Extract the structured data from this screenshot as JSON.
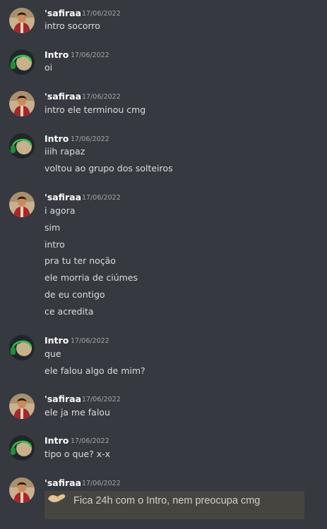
{
  "messages": [
    {
      "author": "'safiraa",
      "timestamp": "17/06/2022",
      "lines": [
        "intro socorro"
      ]
    },
    {
      "author": "Intro",
      "timestamp": "17/06/2022",
      "lines": [
        "oi"
      ]
    },
    {
      "author": "'safiraa",
      "timestamp": "17/06/2022",
      "lines": [
        "intro ele terminou cmg"
      ]
    },
    {
      "author": "Intro",
      "timestamp": "17/06/2022",
      "lines": [
        "iiih rapaz",
        "voltou ao grupo dos solteiros"
      ]
    },
    {
      "author": "'safiraa",
      "timestamp": "17/06/2022",
      "lines": [
        "i agora",
        "sim",
        "intro",
        "pra tu ter noção",
        "ele morria de ciúmes",
        "de eu contigo",
        "ce acredita"
      ]
    },
    {
      "author": "Intro",
      "timestamp": "17/06/2022",
      "lines": [
        "que",
        "ele falou algo de mim?"
      ]
    },
    {
      "author": "'safiraa",
      "timestamp": "17/06/2022",
      "lines": [
        "ele ja me falou"
      ]
    },
    {
      "author": "Intro",
      "timestamp": "17/06/2022",
      "lines": [
        "tipo o que? x-x"
      ]
    },
    {
      "author": "'safiraa",
      "timestamp": "17/06/2022",
      "lines": []
    }
  ],
  "caption": {
    "text": "Fica 24h com o Intro, nem preocupa cmg"
  },
  "colors": {
    "background": "#36393f",
    "username": "#ffffff",
    "timestamp": "#a3a6aa",
    "message_text": "#dcddde",
    "caption_background": "#47453f",
    "caption_text": "#d2d0c9"
  },
  "avatars": {
    "safiraa": "person-avatar",
    "intro": "headphones-avatar"
  }
}
